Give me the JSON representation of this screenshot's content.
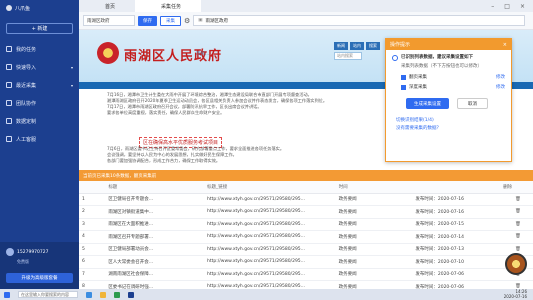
{
  "app": {
    "name": "八爪鱼"
  },
  "sidebar": {
    "new_label": "+ 新建",
    "items": [
      {
        "label": "我的任务"
      },
      {
        "label": "快速导入"
      },
      {
        "label": "最近采集"
      },
      {
        "label": "团队协作"
      },
      {
        "label": "数据定制"
      },
      {
        "label": "人工客服"
      }
    ],
    "user": {
      "name": "15279970727",
      "plan": "免费版",
      "upgrade_label": "升级为高级版套餐"
    }
  },
  "tabs": [
    {
      "label": "首页"
    },
    {
      "label": "采集任务"
    }
  ],
  "toolbar": {
    "input_value": "雨湖区政府",
    "save_label": "保存",
    "collect_label": "采集",
    "url": "雨湖区政府"
  },
  "site": {
    "title": "雨湖区人民政府",
    "subtitle": "市民...",
    "search_placeholder": "站内搜索",
    "tabs": [
      "新闻",
      "站内",
      "搜索"
    ],
    "article_lines": [
      "7月16日，湘潭市卫生计生委在大雨中开展了环境综合整治，湘潭生态建设局联合市直部门开展专项督查活动。",
      "湘潭雨湖区政府召开2020年夏季卫生运动动员会，各区县相关负责人参加会议并作表态发言，确保各项工作落实到位。",
      "7月17日，湘潭市雨湖区政府召开会议，部署防汛抗旱工作，区长出席会议并讲话。",
      "要求各单位高度重视，落实责任，确保人民群众生命财产安全。"
    ],
    "highlight_title": "区在确保高水平优质服务考试项目",
    "article2_lines": [
      "7月6日，雨湖区委书记主持召开区委常委会，研究部署重点工作，要求全面推进各项任务落实。",
      "会议强调，要坚持以人民为中心的发展思想，扎实做好民生保障工作。",
      "各部门要加强协调配合，形成工作合力，确保工作取得实效。"
    ]
  },
  "popup": {
    "header": "操作提示",
    "close": "×",
    "title": "已识别列表数据，建议采集设置如下",
    "subtitle": "采集列表数据（不下方按钮也可以修改）",
    "checks": [
      {
        "label": "翻页采集",
        "link": "修改"
      },
      {
        "label": "深度采集",
        "link": "修改"
      }
    ],
    "start_label": "生成采集设置",
    "cancel_label": "取消",
    "link1": "切换识别结果(1/4)",
    "link2": "没有需要采集的数据？"
  },
  "data_bar": {
    "text": "当前页已采集10条数据，翻页采集前"
  },
  "table": {
    "headers": [
      "",
      "标题",
      "标题_链接",
      "时间",
      "",
      "",
      "删除"
    ],
    "rows": [
      {
        "n": "1",
        "title": "区卫健局召开专题会...",
        "link": "http://www.xtyh.gov.cn/29571/29580/295...",
        "src": "政务要闻",
        "date": "发布时间：2020-07-16"
      },
      {
        "n": "2",
        "title": "雨湖区对镇街道集中...",
        "link": "http://www.xtyh.gov.cn/29571/29580/295...",
        "src": "政务要闻",
        "date": "发布时间：2020-07-16"
      },
      {
        "n": "3",
        "title": "雨湖区在大面积推进...",
        "link": "http://www.xtyh.gov.cn/29571/29580/295...",
        "src": "政务要闻",
        "date": "发布时间：2020-07-15"
      },
      {
        "n": "4",
        "title": "雨湖区召开专题部署...",
        "link": "http://www.xtyh.gov.cn/29571/29580/295...",
        "src": "政务要闻",
        "date": "发布时间：2020-07-14"
      },
      {
        "n": "5",
        "title": "区卫健局部署动员会...",
        "link": "http://www.xtyh.gov.cn/29571/29580/295...",
        "src": "政务要闻",
        "date": "发布时间：2020-07-13"
      },
      {
        "n": "6",
        "title": "区人大常委会召开会...",
        "link": "http://www.xtyh.gov.cn/29571/29580/295...",
        "src": "政务要闻",
        "date": "发布时间：2020-07-10"
      },
      {
        "n": "7",
        "title": "湖南雨湖区社会保障...",
        "link": "http://www.xtyh.gov.cn/29571/29580/295...",
        "src": "政务要闻",
        "date": "发布时间：2020-07-06"
      },
      {
        "n": "8",
        "title": "区委书记在调研时强...",
        "link": "http://www.xtyh.gov.cn/29571/29580/295...",
        "src": "政务要闻",
        "date": "发布时间：2020-07-06"
      }
    ]
  },
  "taskbar": {
    "search_placeholder": "在这里输入你要搜索的内容",
    "time": "14:26",
    "date": "2020-07-16"
  }
}
